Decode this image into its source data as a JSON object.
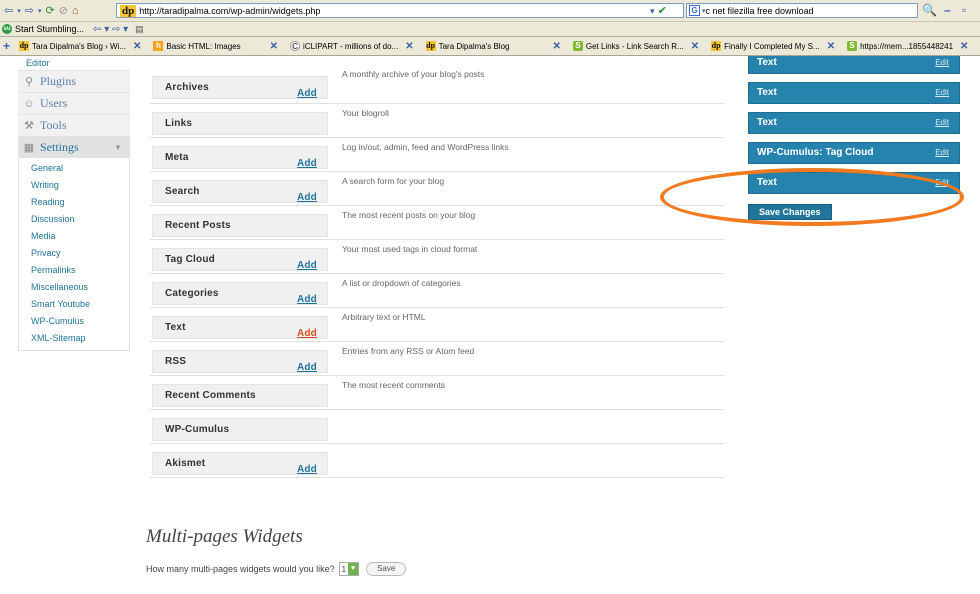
{
  "browser": {
    "url": "http://taradipalma.com/wp-admin/widgets.php",
    "search_value": "c net filezilla free download",
    "stumble_label": "Start Stumbling...",
    "tabs": [
      {
        "label": "Tara Dipalma's Blog › Wi...",
        "favicon": "dp"
      },
      {
        "label": "Basic HTML: Images",
        "favicon": "html"
      },
      {
        "label": "iCLIPART - millions of do...",
        "favicon": "c"
      },
      {
        "label": "Tara Dipalma's Blog",
        "favicon": "dp"
      },
      {
        "label": "Get Links - Link Search R...",
        "favicon": "s"
      },
      {
        "label": "Finally I Completed My S...",
        "favicon": "dp"
      },
      {
        "label": "https://mem...1855448241",
        "favicon": "s"
      }
    ]
  },
  "sidebar": {
    "editor_label": "Editor",
    "menus": [
      {
        "label": "Plugins",
        "icon": "plug-icon"
      },
      {
        "label": "Users",
        "icon": "users-icon"
      },
      {
        "label": "Tools",
        "icon": "tools-icon"
      },
      {
        "label": "Settings",
        "icon": "settings-icon"
      }
    ],
    "settings_submenu": [
      "General",
      "Writing",
      "Reading",
      "Discussion",
      "Media",
      "Privacy",
      "Permalinks",
      "Miscellaneous",
      "Smart Youtube",
      "WP-Cumulus",
      "XML-Sitemap"
    ]
  },
  "available_widgets": [
    {
      "title": "Archives",
      "add": "Add",
      "desc": "A monthly archive of your blog's posts"
    },
    {
      "title": "Links",
      "add": "",
      "desc": "Your blogroll"
    },
    {
      "title": "Meta",
      "add": "Add",
      "desc": "Log in/out, admin, feed and WordPress links"
    },
    {
      "title": "Search",
      "add": "Add",
      "desc": "A search form for your blog"
    },
    {
      "title": "Recent Posts",
      "add": "",
      "desc": "The most recent posts on your blog"
    },
    {
      "title": "Tag Cloud",
      "add": "Add",
      "desc": "Your most used tags in cloud format"
    },
    {
      "title": "Categories",
      "add": "Add",
      "desc": "A list or dropdown of categories"
    },
    {
      "title": "Text",
      "add": "Add",
      "desc": "Arbitrary text or HTML"
    },
    {
      "title": "RSS",
      "add": "Add",
      "desc": "Entries from any RSS or Atom feed"
    },
    {
      "title": "Recent Comments",
      "add": "",
      "desc": "The most recent comments"
    },
    {
      "title": "WP-Cumulus",
      "add": "",
      "desc": ""
    },
    {
      "title": "Akismet",
      "add": "Add",
      "desc": ""
    }
  ],
  "current_widgets": [
    {
      "title": "Text",
      "edit": "Edit"
    },
    {
      "title": "Text",
      "edit": "Edit"
    },
    {
      "title": "Text",
      "edit": "Edit"
    },
    {
      "title": "WP-Cumulus: Tag Cloud",
      "edit": "Edit"
    },
    {
      "title": "Text",
      "edit": "Edit"
    }
  ],
  "save_changes_label": "Save Changes",
  "multi": {
    "title": "Multi-pages Widgets",
    "question": "How many multi-pages widgets would you like?",
    "count_value": "1",
    "save_label": "Save"
  },
  "colors": {
    "widget_blue": "#2583ad",
    "link_blue": "#21759b",
    "highlight_orange": "#f27a1f",
    "add_hover": "#d54e21"
  }
}
